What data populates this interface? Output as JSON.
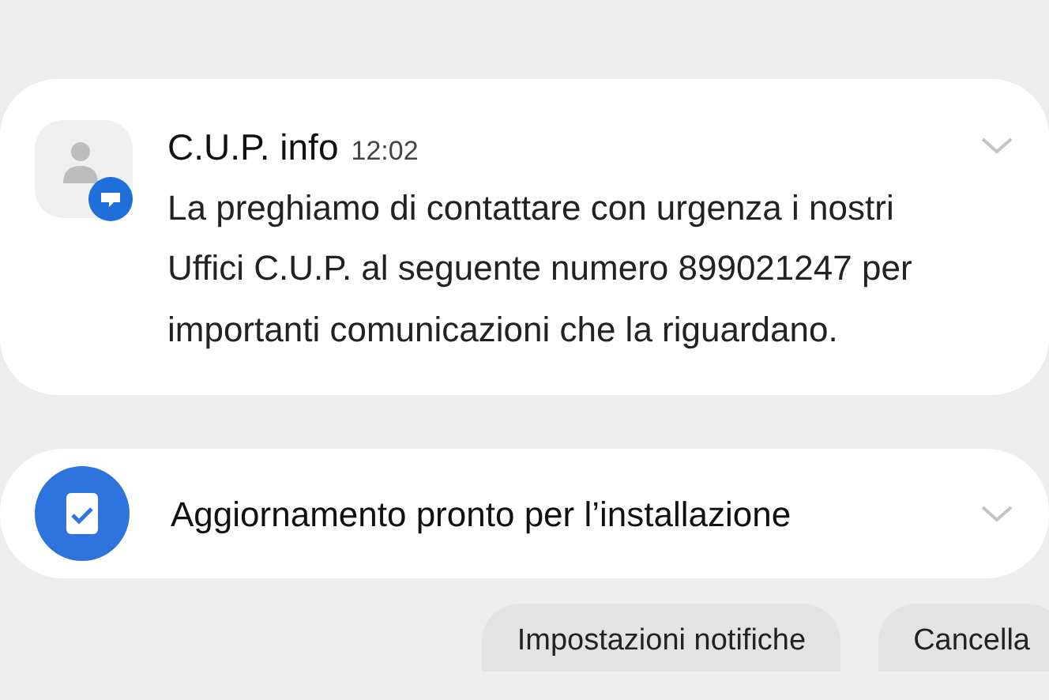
{
  "notifications": [
    {
      "kind": "message",
      "app": "C.U.P. info",
      "time": "12:02",
      "body": "La preghiamo di contattare con urgenza i nostri Uffici C.U.P. al seguente numero 899021247 per importanti comunicazioni che la riguardano."
    },
    {
      "kind": "update",
      "title": "Aggiornamento pronto per l’installazione"
    }
  ],
  "buttons": [
    "Impostazioni notifiche",
    "Cancella"
  ]
}
